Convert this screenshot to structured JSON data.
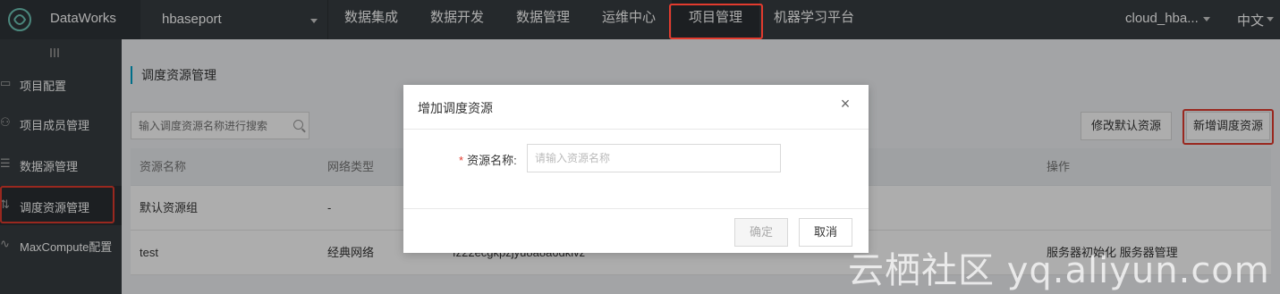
{
  "topbar": {
    "logo_text": "DataWorks",
    "project_name": "hbaseport",
    "nav": [
      {
        "label": "数据集成"
      },
      {
        "label": "数据开发"
      },
      {
        "label": "数据管理"
      },
      {
        "label": "运维中心"
      },
      {
        "label": "项目管理",
        "active": true
      },
      {
        "label": "机器学习平台"
      }
    ],
    "user": "cloud_hba...",
    "language": "中文"
  },
  "sidebar": {
    "items": [
      {
        "label": "项目配置",
        "icon": "folder-icon"
      },
      {
        "label": "项目成员管理",
        "icon": "user-icon"
      },
      {
        "label": "数据源管理",
        "icon": "database-icon"
      },
      {
        "label": "调度资源管理",
        "icon": "sliders-icon",
        "active": true
      },
      {
        "label": "MaxCompute配置",
        "icon": "pulse-icon"
      }
    ]
  },
  "main": {
    "title": "调度资源管理",
    "search_placeholder": "输入调度资源名称进行搜索",
    "modify_default_button": "修改默认资源",
    "add_resource_button": "新增调度资源",
    "table": {
      "headers": [
        "资源名称",
        "网络类型",
        "操作"
      ],
      "rows": [
        {
          "name": "默认资源组",
          "network": "-",
          "mid": "",
          "actions": ""
        },
        {
          "name": "test",
          "network": "经典网络",
          "mid": "fz22ecgkpzjyu8a8a6dkivz",
          "actions": "服务器初始化 服务器管理"
        }
      ]
    }
  },
  "modal": {
    "title": "增加调度资源",
    "field_label": "资源名称:",
    "field_placeholder": "请输入资源名称",
    "ok_button": "确定",
    "cancel_button": "取消"
  },
  "watermark": "云栖社区 yq.aliyun.com",
  "colors": {
    "highlight": "#e23b2e",
    "accent": "#00a2ca",
    "topbar": "#373d41"
  }
}
